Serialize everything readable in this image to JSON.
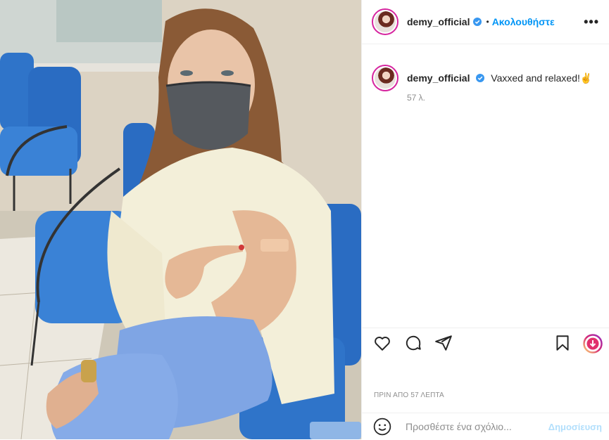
{
  "header": {
    "username": "demy_official",
    "separator": "•",
    "follow_label": "Ακολουθήστε",
    "more_label": "•••"
  },
  "caption": {
    "username": "demy_official",
    "text": "Vaxxed and relaxed!",
    "emoji": "✌",
    "time": "57 λ."
  },
  "actions": {
    "icons": [
      "heart-icon",
      "comment-icon",
      "share-icon",
      "bookmark-icon",
      "promo-icon"
    ]
  },
  "dateline": "ΠΡΙΝ ΑΠΟ 57 ΛΕΠΤΑ",
  "comment": {
    "placeholder": "Προσθέστε ένα σχόλιο...",
    "post_label": "Δημοσίευση"
  },
  "colors": {
    "accent": "#0095f6",
    "verified": "#3897f0",
    "post_disabled": "#b2dffc",
    "muted": "#8e8e8e"
  }
}
